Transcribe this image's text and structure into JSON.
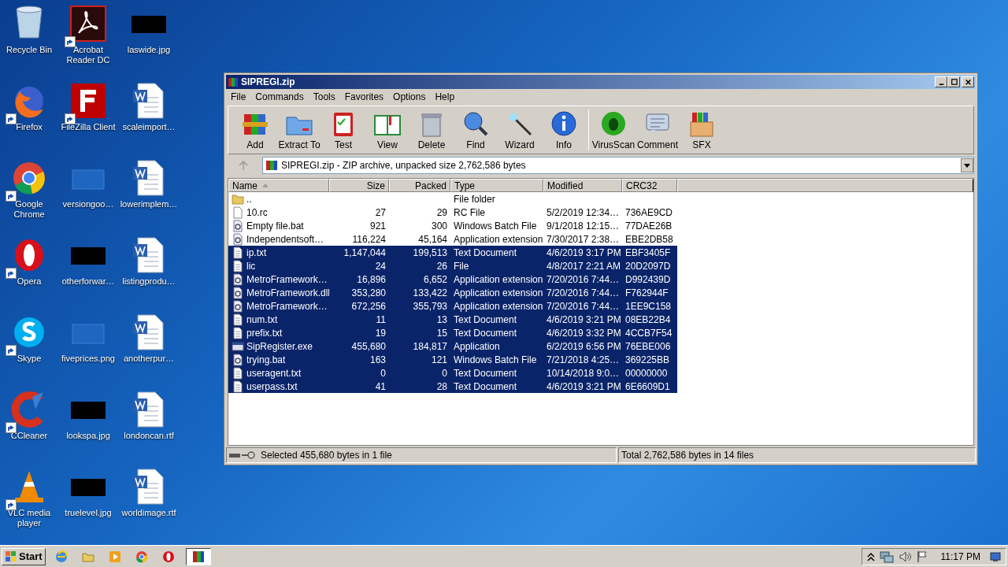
{
  "desktop": {
    "icons": [
      {
        "label": "Recycle Bin",
        "kind": "recycle",
        "shortcut": false
      },
      {
        "label": "Firefox",
        "kind": "firefox",
        "shortcut": true
      },
      {
        "label": "Google Chrome",
        "kind": "chrome",
        "shortcut": true
      },
      {
        "label": "Opera",
        "kind": "opera",
        "shortcut": true
      },
      {
        "label": "Skype",
        "kind": "skype",
        "shortcut": true
      },
      {
        "label": "CCleaner",
        "kind": "ccleaner",
        "shortcut": true
      },
      {
        "label": "VLC media player",
        "kind": "vlc",
        "shortcut": true
      },
      {
        "label": "Acrobat Reader DC",
        "kind": "acrobat",
        "shortcut": true
      },
      {
        "label": "FileZilla Client",
        "kind": "filezilla",
        "shortcut": true
      },
      {
        "label": "versiongoo…",
        "kind": "blank",
        "shortcut": false
      },
      {
        "label": "otherforwar…",
        "kind": "black",
        "shortcut": false
      },
      {
        "label": "fiveprices.png",
        "kind": "blank",
        "shortcut": false
      },
      {
        "label": "lookspa.jpg",
        "kind": "black",
        "shortcut": false
      },
      {
        "label": "truelevel.jpg",
        "kind": "black",
        "shortcut": false
      },
      {
        "label": "laswide.jpg",
        "kind": "black",
        "shortcut": false
      },
      {
        "label": "scaleimport…",
        "kind": "word",
        "shortcut": false
      },
      {
        "label": "lowerimplem…",
        "kind": "word",
        "shortcut": false
      },
      {
        "label": "listingprodu…",
        "kind": "word",
        "shortcut": false
      },
      {
        "label": "anotherpur…",
        "kind": "word",
        "shortcut": false
      },
      {
        "label": "londoncan.rtf",
        "kind": "word",
        "shortcut": false
      },
      {
        "label": "worldimage.rtf",
        "kind": "word",
        "shortcut": false
      }
    ]
  },
  "window": {
    "title": "SIPREGI.zip",
    "menu": [
      "File",
      "Commands",
      "Tools",
      "Favorites",
      "Options",
      "Help"
    ],
    "toolbar": [
      {
        "label": "Add",
        "kind": "add"
      },
      {
        "label": "Extract To",
        "kind": "extract"
      },
      {
        "label": "Test",
        "kind": "test"
      },
      {
        "label": "View",
        "kind": "view"
      },
      {
        "label": "Delete",
        "kind": "delete"
      },
      {
        "label": "Find",
        "kind": "find"
      },
      {
        "label": "Wizard",
        "kind": "wizard"
      },
      {
        "label": "Info",
        "kind": "info"
      },
      {
        "label": "VirusScan",
        "kind": "virus"
      },
      {
        "label": "Comment",
        "kind": "comment"
      },
      {
        "label": "SFX",
        "kind": "sfx"
      }
    ],
    "address": "SIPREGI.zip - ZIP archive, unpacked size 2,762,586 bytes",
    "table": {
      "columns": [
        "Name",
        "Size",
        "Packed",
        "Type",
        "Modified",
        "CRC32"
      ],
      "rows": [
        {
          "kind": "folder",
          "selected": false,
          "cells": [
            "..",
            "",
            "",
            "File folder",
            "",
            ""
          ]
        },
        {
          "kind": "file",
          "selected": false,
          "cells": [
            "10.rc",
            "27",
            "29",
            "RC File",
            "5/2/2019 12:34…",
            "736AE9CD"
          ]
        },
        {
          "kind": "gear",
          "selected": false,
          "cells": [
            "Empty file.bat",
            "921",
            "300",
            "Windows Batch File",
            "9/1/2018 12:15…",
            "77DAE26B"
          ]
        },
        {
          "kind": "gear",
          "selected": false,
          "cells": [
            "Independentsoft…",
            "116,224",
            "45,164",
            "Application extension",
            "7/30/2017 2:38…",
            "EBE2DB58"
          ]
        },
        {
          "kind": "doc",
          "selected": true,
          "cells": [
            "ip.txt",
            "1,147,044",
            "199,513",
            "Text Document",
            "4/6/2019 3:17 PM",
            "EBF3405F"
          ]
        },
        {
          "kind": "doc",
          "selected": true,
          "cells": [
            "lic",
            "24",
            "26",
            "File",
            "4/8/2017 2:21 AM",
            "20D2097D"
          ]
        },
        {
          "kind": "gear",
          "selected": true,
          "cells": [
            "MetroFramework…",
            "16,896",
            "6,652",
            "Application extension",
            "7/20/2016 7:44…",
            "D992439D"
          ]
        },
        {
          "kind": "gear",
          "selected": true,
          "cells": [
            "MetroFramework.dll",
            "353,280",
            "133,422",
            "Application extension",
            "7/20/2016 7:44…",
            "F762944F"
          ]
        },
        {
          "kind": "gear",
          "selected": true,
          "cells": [
            "MetroFramework…",
            "672,256",
            "355,793",
            "Application extension",
            "7/20/2016 7:44…",
            "1EE9C158"
          ]
        },
        {
          "kind": "doc",
          "selected": true,
          "cells": [
            "num.txt",
            "11",
            "13",
            "Text Document",
            "4/6/2019 3:21 PM",
            "08EB22B4"
          ]
        },
        {
          "kind": "doc",
          "selected": true,
          "cells": [
            "prefix.txt",
            "19",
            "15",
            "Text Document",
            "4/6/2019 3:32 PM",
            "4CCB7F54"
          ]
        },
        {
          "kind": "exe",
          "selected": true,
          "cells": [
            "SipRegister.exe",
            "455,680",
            "184,817",
            "Application",
            "6/2/2019 6:56 PM",
            "76EBE006"
          ]
        },
        {
          "kind": "gear",
          "selected": true,
          "cells": [
            "trying.bat",
            "163",
            "121",
            "Windows Batch File",
            "7/21/2018 4:25…",
            "369225BB"
          ]
        },
        {
          "kind": "doc",
          "selected": true,
          "cells": [
            "useragent.txt",
            "0",
            "0",
            "Text Document",
            "10/14/2018 9:0…",
            "00000000"
          ]
        },
        {
          "kind": "doc",
          "selected": true,
          "cells": [
            "userpass.txt",
            "41",
            "28",
            "Text Document",
            "4/6/2019 3:21 PM",
            "6E6609D1"
          ]
        }
      ]
    },
    "status": {
      "left": "Selected 455,680 bytes in 1 file",
      "right": "Total 2,762,586 bytes in 14 files"
    }
  },
  "taskbar": {
    "start": "Start",
    "apps": [
      {
        "kind": "ie",
        "selected": false
      },
      {
        "kind": "explorer",
        "selected": false
      },
      {
        "kind": "media",
        "selected": false
      },
      {
        "kind": "chrome",
        "selected": false
      },
      {
        "kind": "opera",
        "selected": false
      },
      {
        "kind": "winrar",
        "selected": true
      }
    ],
    "clock": "11:17 PM"
  }
}
